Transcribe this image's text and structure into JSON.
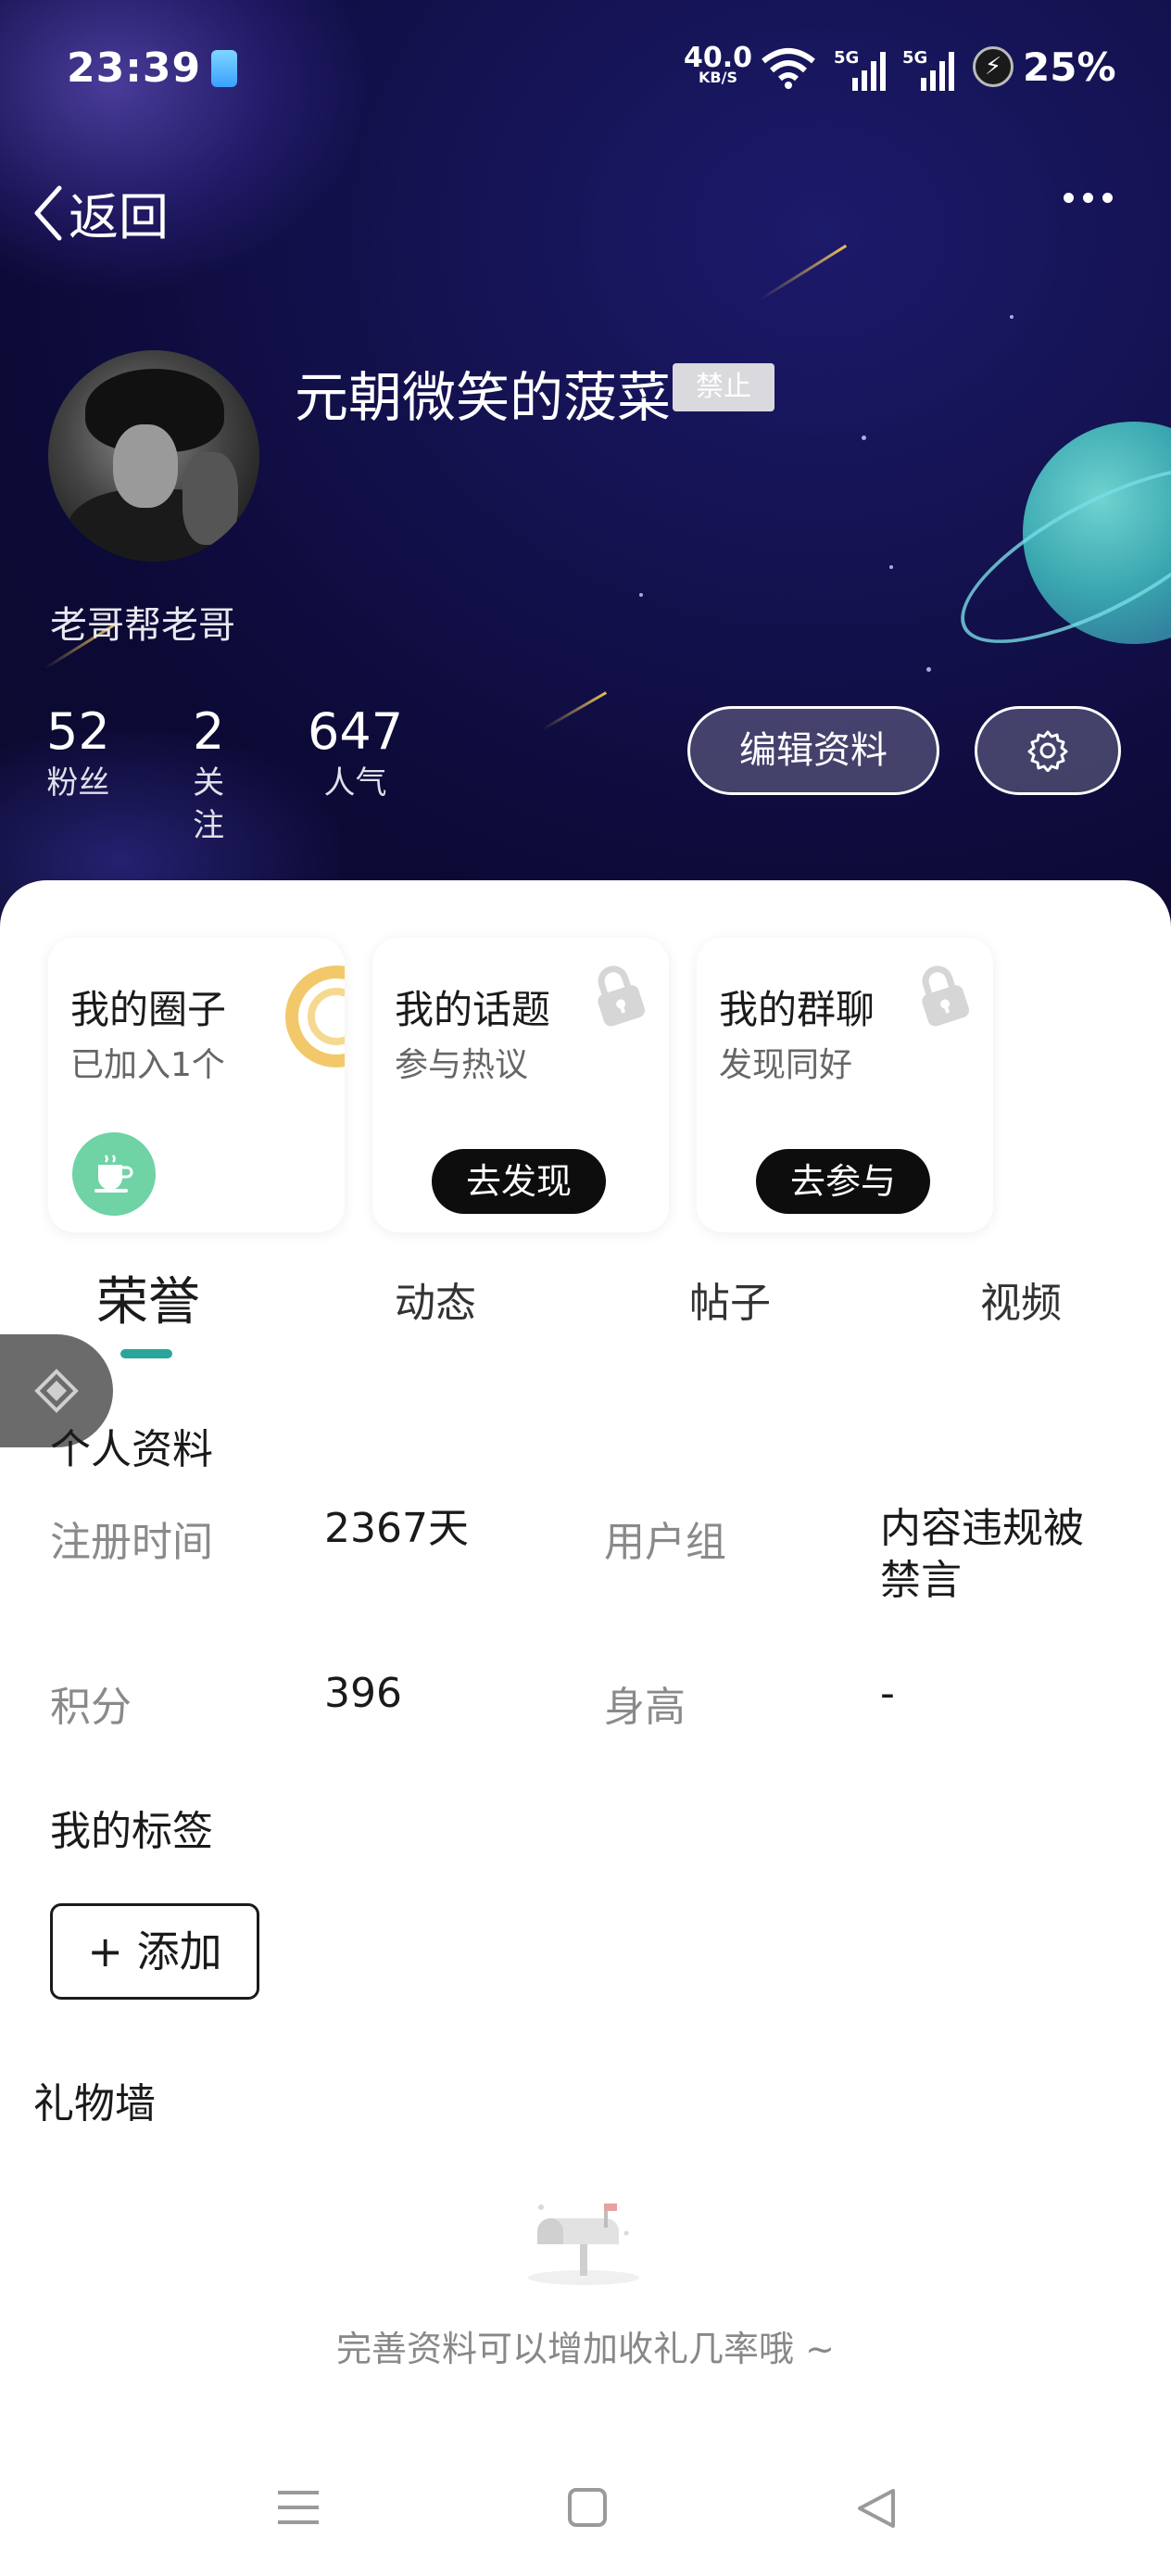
{
  "status_bar": {
    "time": "23:39",
    "net_speed": "40.0",
    "net_speed_unit": "KB/S",
    "signal1": "5G",
    "signal2": "5G",
    "battery": "25%"
  },
  "header": {
    "back_label": "返回",
    "username": "元朝微笑的菠菜",
    "ban_badge": "禁止",
    "signature": "老哥帮老哥",
    "stats": [
      {
        "value": "52",
        "label": "粉丝"
      },
      {
        "value": "2",
        "label": "关注"
      },
      {
        "value": "647",
        "label": "人气"
      }
    ],
    "edit_button": "编辑资料"
  },
  "cards": [
    {
      "title": "我的圈子",
      "subtitle": "已加入1个"
    },
    {
      "title": "我的话题",
      "subtitle": "参与热议",
      "button": "去发现"
    },
    {
      "title": "我的群聊",
      "subtitle": "发现同好",
      "button": "去参与"
    }
  ],
  "tabs": [
    {
      "label": "荣誉",
      "active": true
    },
    {
      "label": "动态",
      "active": false
    },
    {
      "label": "帖子",
      "active": false
    },
    {
      "label": "视频",
      "active": false
    }
  ],
  "profile": {
    "section_title": "个人资料",
    "fields": {
      "reg_time_label": "注册时间",
      "reg_time_value": "2367天",
      "group_label": "用户组",
      "group_value_line1": "内容违规被",
      "group_value_line2": "禁言",
      "points_label": "积分",
      "points_value": "396",
      "height_label": "身高",
      "height_value": "-"
    }
  },
  "tags": {
    "section_title": "我的标签",
    "add_button": "+ 添加"
  },
  "gifts": {
    "section_title": "礼物墙",
    "empty_text": "完善资料可以增加收礼几率哦 ~"
  },
  "colors": {
    "accent": "#2aa59a",
    "header_bg": "#141250",
    "button_dark": "#0d0d0d"
  }
}
